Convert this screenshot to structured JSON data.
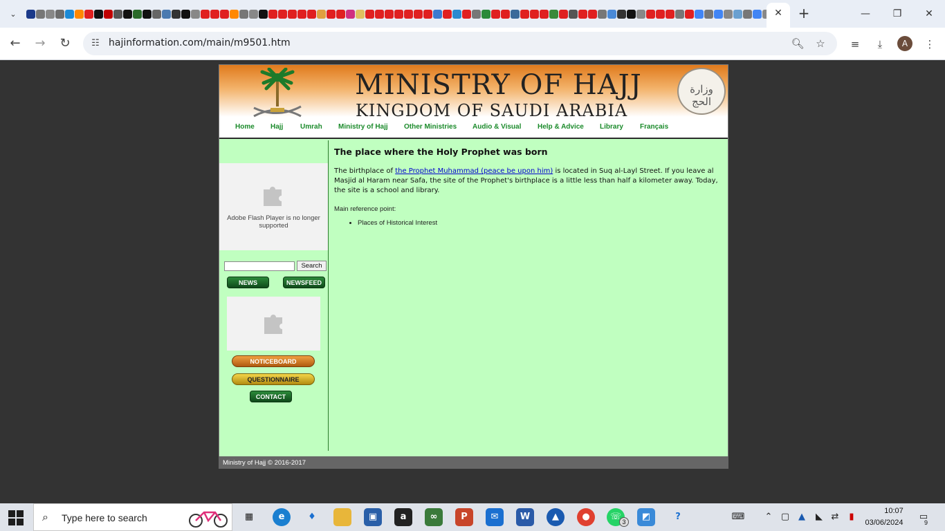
{
  "browser": {
    "url": "hajinformation.com/main/m9501.htm",
    "profile_initial": "A",
    "favicon_colors": [
      "#1b3a8a",
      "#777777",
      "#888888",
      "#6d6d6d",
      "#1c8ad6",
      "#ff8800",
      "#e02020",
      "#111111",
      "#c00000",
      "#555555",
      "#111111",
      "#2a6a2a",
      "#111111",
      "#666666",
      "#4a7ab0",
      "#333333",
      "#111111",
      "#888888",
      "#e02020",
      "#e02020",
      "#e02020",
      "#ff8800",
      "#777777",
      "#888888",
      "#111111",
      "#e02020",
      "#e02020",
      "#e02020",
      "#e02020",
      "#e02020",
      "#e0a040",
      "#e02020",
      "#e02020",
      "#d03080",
      "#e0c060",
      "#e02020",
      "#e02020",
      "#e02020",
      "#e02020",
      "#e02020",
      "#e02020",
      "#e02020",
      "#3a7ad0",
      "#e02020",
      "#2a8ad0",
      "#e02020",
      "#777777",
      "#2a8a3a",
      "#e02020",
      "#e02020",
      "#3a6a9a",
      "#e02020",
      "#e02020",
      "#e02020",
      "#3a8a3a",
      "#e02020",
      "#555555",
      "#e02020",
      "#e02020",
      "#777777",
      "#4a8ad8",
      "#333333",
      "#111111",
      "#888888",
      "#e02020",
      "#e02020",
      "#e02020",
      "#777777",
      "#e02020",
      "#4285f4",
      "#777777",
      "#4285f4",
      "#888888",
      "#6aa0d0",
      "#777777",
      "#4285f4",
      "#888888"
    ]
  },
  "site": {
    "title": "MINISTRY OF HAJJ",
    "subtitle": "KINGDOM OF SAUDI ARABIA",
    "seal_text": "وزارة الحج",
    "nav": [
      "Home",
      "Hajj",
      "Umrah",
      "Ministry of Hajj",
      "Other Ministries",
      "Audio & Visual",
      "Help & Advice",
      "Library",
      "Français"
    ]
  },
  "sidebar": {
    "flash_message": "Adobe Flash Player is no longer supported",
    "search_button": "Search",
    "news_button": "NEWS",
    "newsfeed_button": "NEWSFEED",
    "noticeboard_button": "NOTICEBOARD",
    "questionnaire_button": "QUESTIONNAIRE",
    "contact_button": "CONTACT"
  },
  "content": {
    "heading": "The place where the Holy Prophet was born",
    "body_prefix": "The birthplace of ",
    "body_link": "the Prophet Muhammad (peace be upon him)",
    "body_suffix": " is located in Suq al-Layl Street. If you leave al Masjid al Haram near Safa, the site of the Prophet's birthplace is a little less than half a kilometer away. Today, the site is a school and library.",
    "ref_label": "Main reference point:",
    "ref_items": [
      "Places of Historical Interest"
    ]
  },
  "footer": {
    "text": "Ministry of Hajj © 2016-2017"
  },
  "taskbar": {
    "search_placeholder": "Type here to search",
    "time": "10:07",
    "date": "03/06/2024",
    "whatsapp_badge": "3",
    "notification_count": "9"
  }
}
